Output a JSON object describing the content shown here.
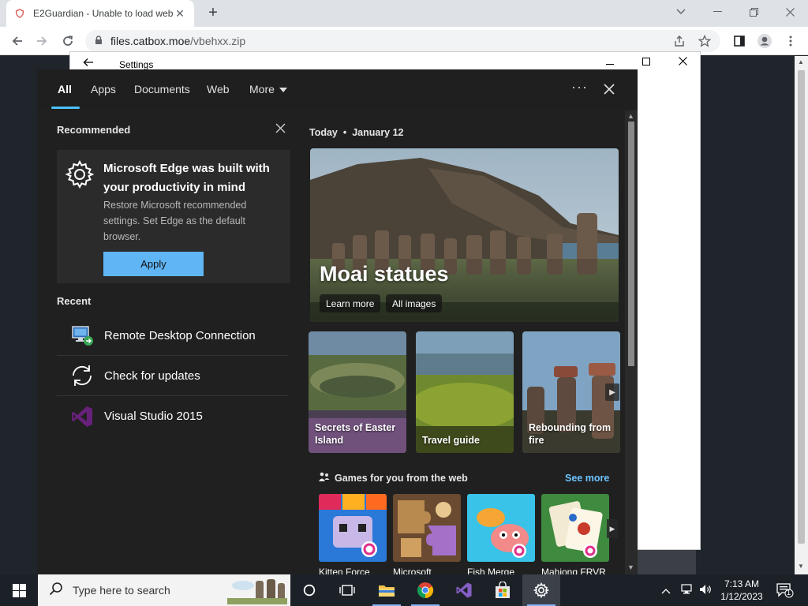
{
  "browser": {
    "tab_title": "E2Guardian - Unable to load web",
    "tab_close": "✕",
    "new_tab": "+",
    "url_host": "files.catbox.moe",
    "url_path": "/vbehxx.zip"
  },
  "settings_window": {
    "title": "Settings"
  },
  "search_panel": {
    "tabs": [
      "All",
      "Apps",
      "Documents",
      "Web",
      "More"
    ],
    "recommended_title": "Recommended",
    "recommendation": {
      "heading": "Microsoft Edge was built with your productivity in mind",
      "body": "Restore Microsoft recommended settings. Set Edge as the default browser.",
      "button": "Apply"
    },
    "recent_title": "Recent",
    "recent": [
      {
        "label": "Remote Desktop Connection",
        "icon": "remote-desktop-icon"
      },
      {
        "label": "Check for updates",
        "icon": "sync-icon"
      },
      {
        "label": "Visual Studio 2015",
        "icon": "visual-studio-icon"
      }
    ],
    "today_label": "Today",
    "today_date": "January 12",
    "hero": {
      "title": "Moai statues",
      "learn_more": "Learn more",
      "all_images": "All images"
    },
    "cards": [
      {
        "label": "Secrets of Easter Island"
      },
      {
        "label": "Travel guide"
      },
      {
        "label": "Rebounding from fire"
      }
    ],
    "games_title": "Games for you from the web",
    "see_more": "See more",
    "games": [
      {
        "label": "Kitten Force"
      },
      {
        "label": "Microsoft"
      },
      {
        "label": "Fish Merge"
      },
      {
        "label": "Mahjong FRVR"
      }
    ]
  },
  "taskbar": {
    "search_placeholder": "Type here to search",
    "time": "7:13 AM",
    "date": "1/12/2023",
    "notification_count": "1"
  },
  "colors": {
    "accent": "#4cc2ff",
    "apply_button": "#60b5f5",
    "see_more": "#6cc4ff"
  }
}
